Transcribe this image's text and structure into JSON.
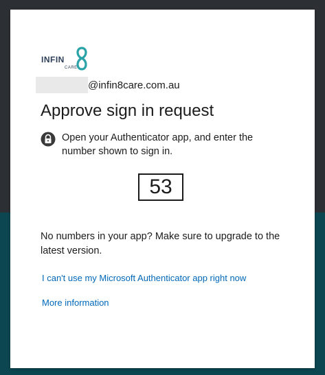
{
  "brand": {
    "word": "INFIN",
    "sub": "CARE",
    "accent": "#2aa3a8"
  },
  "identity": {
    "email_domain": "@infin8care.com.au"
  },
  "title": "Approve sign in request",
  "instruction": "Open your Authenticator app, and enter the number shown to sign in.",
  "number": "53",
  "note": "No numbers in your app? Make sure to upgrade to the latest version.",
  "links": {
    "cant_use": "I can't use my Microsoft Authenticator app right now",
    "more_info": "More information"
  },
  "colors": {
    "link": "#0067b8",
    "bg_top": "#2c2f33",
    "bg_bottom": "#0c4651"
  },
  "icons": {
    "instruction": "lock-icon"
  }
}
